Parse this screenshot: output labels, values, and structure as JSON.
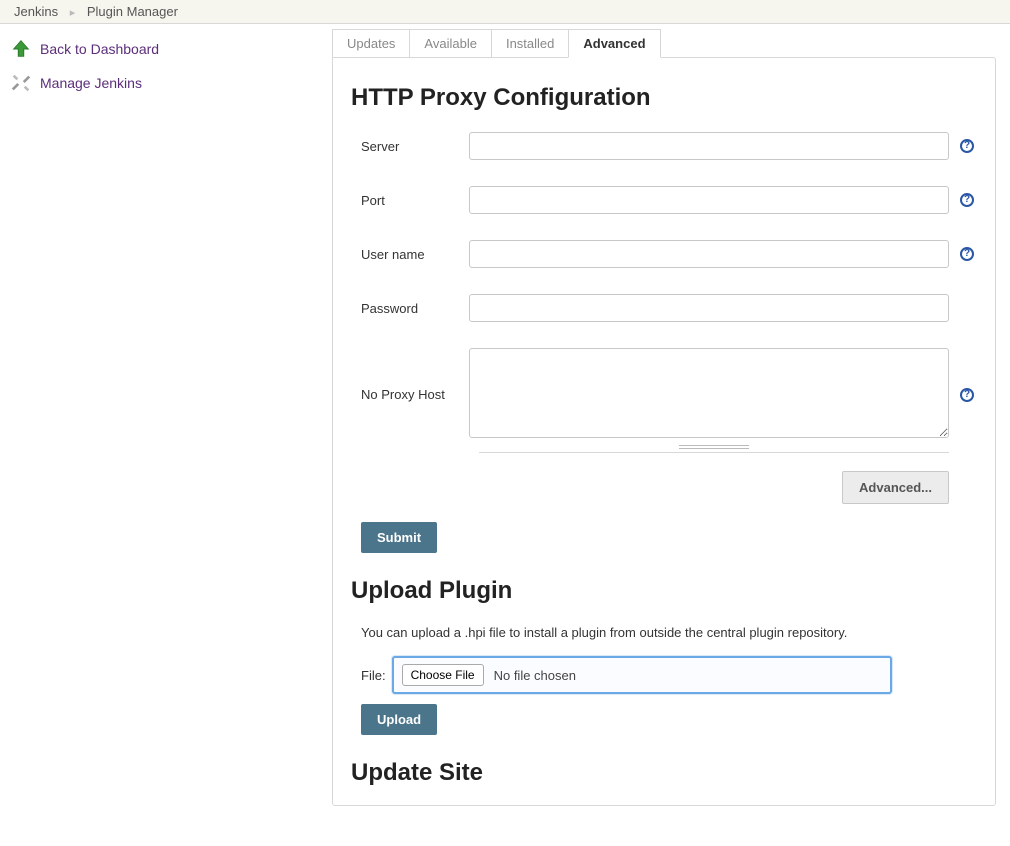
{
  "breadcrumb": {
    "items": [
      "Jenkins",
      "Plugin Manager"
    ]
  },
  "sidebar": {
    "items": [
      {
        "label": "Back to Dashboard"
      },
      {
        "label": "Manage Jenkins"
      }
    ]
  },
  "tabs": [
    {
      "label": "Updates",
      "active": false
    },
    {
      "label": "Available",
      "active": false
    },
    {
      "label": "Installed",
      "active": false
    },
    {
      "label": "Advanced",
      "active": true
    }
  ],
  "proxy": {
    "heading": "HTTP Proxy Configuration",
    "server_label": "Server",
    "port_label": "Port",
    "user_label": "User name",
    "password_label": "Password",
    "noproxy_label": "No Proxy Host",
    "server": "",
    "port": "",
    "user": "",
    "password": "",
    "noproxy": "",
    "advanced_button": "Advanced...",
    "submit_button": "Submit"
  },
  "upload": {
    "heading": "Upload Plugin",
    "description": "You can upload a .hpi file to install a plugin from outside the central plugin repository.",
    "file_label": "File:",
    "choose_button": "Choose File",
    "file_status": "No file chosen",
    "upload_button": "Upload"
  },
  "updatesite": {
    "heading": "Update Site"
  }
}
